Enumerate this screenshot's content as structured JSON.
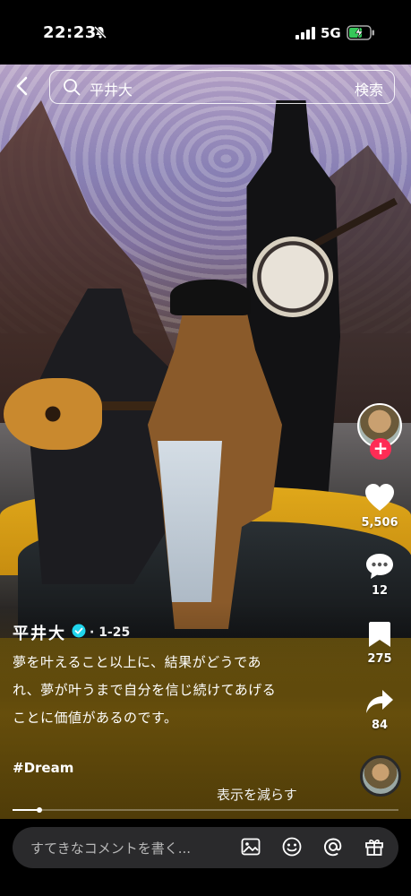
{
  "status_bar": {
    "time": "22:23",
    "network": "5G"
  },
  "search": {
    "query": "平井大",
    "button_label": "検索"
  },
  "right_rail": {
    "likes": "5,506",
    "comments": "12",
    "saves": "275",
    "shares": "84",
    "follow_symbol": "+"
  },
  "post": {
    "author": "平井大",
    "date": "· 1-25",
    "caption_lines": [
      "夢を叶えること以上に、結果がどうであ",
      "れ、夢が叶うまで自分を信じ続けてあげる",
      "ことに価値があるのです。"
    ],
    "hashtag": "#Dream",
    "show_less_label": "表示を減らす",
    "progress": 0.07
  },
  "comment_bar": {
    "placeholder": "すてきなコメントを書く..."
  },
  "icons": {
    "back": "back-chevron-icon",
    "search": "search-icon",
    "mute": "bell-slash-icon",
    "verified": "verified-check-icon",
    "like": "heart-icon",
    "comment": "speech-bubble-icon",
    "save": "bookmark-icon",
    "share": "share-arrow-icon",
    "image": "image-icon",
    "emoji": "emoji-icon",
    "mention": "at-sign-icon",
    "gift": "gift-icon"
  },
  "colors": {
    "accent": "#fe2c55",
    "verified": "#20d5ec",
    "battery": "#35c759"
  }
}
